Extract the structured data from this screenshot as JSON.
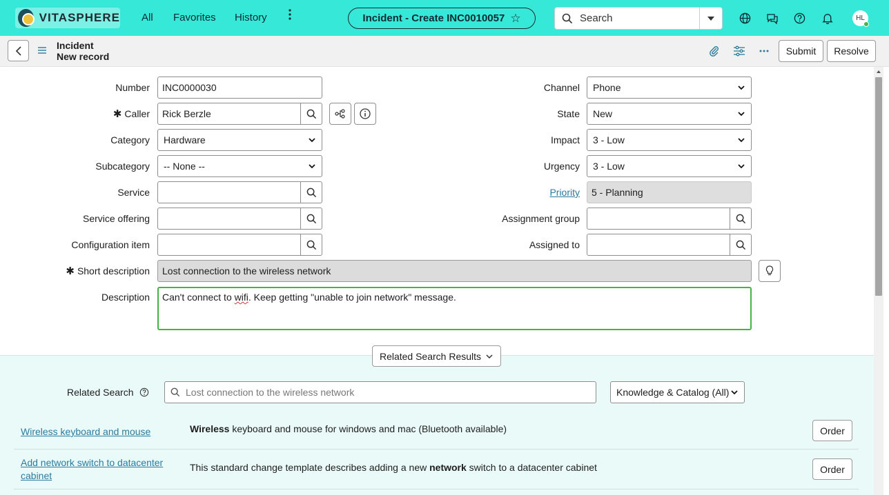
{
  "topnav": {
    "brand": "VITASPHERE",
    "links": [
      "All",
      "Favorites",
      "History"
    ],
    "more_icon": "more-vertical-icon",
    "context_title": "Incident - Create INC0010057",
    "search_label": "Search",
    "icons": [
      "globe-icon",
      "chat-icon",
      "help-icon",
      "bell-icon"
    ],
    "user_initials": "HL",
    "bg_color": "#36e8d8"
  },
  "form_header": {
    "table": "Incident",
    "record": "New record",
    "submit_label": "Submit",
    "resolve_label": "Resolve"
  },
  "fields_left": {
    "number": {
      "label": "Number",
      "value": "INC0000030"
    },
    "caller": {
      "label": "Caller",
      "value": "Rick Berzle"
    },
    "category": {
      "label": "Category",
      "value": "Hardware"
    },
    "subcategory": {
      "label": "Subcategory",
      "value": "-- None --"
    },
    "service": {
      "label": "Service",
      "value": ""
    },
    "service_offering": {
      "label": "Service offering",
      "value": ""
    },
    "configuration_item": {
      "label": "Configuration item",
      "value": ""
    }
  },
  "fields_right": {
    "channel": {
      "label": "Channel",
      "value": "Phone"
    },
    "state": {
      "label": "State",
      "value": "New"
    },
    "impact": {
      "label": "Impact",
      "value": "3 - Low"
    },
    "urgency": {
      "label": "Urgency",
      "value": "3 - Low"
    },
    "priority": {
      "label": "Priority",
      "value": "5 - Planning"
    },
    "assignment_group": {
      "label": "Assignment group",
      "value": ""
    },
    "assigned_to": {
      "label": "Assigned to",
      "value": ""
    }
  },
  "short_description": {
    "label": "Short description",
    "value": "Lost connection to the wireless network"
  },
  "description": {
    "label": "Description",
    "value_before": "Can't connect to ",
    "value_misspelled": "wifi",
    "value_after": ". Keep getting \"unable to join network\" message."
  },
  "related": {
    "toggle_label": "Related Search Results",
    "search_label": "Related Search",
    "search_placeholder": "Lost connection to the wireless network",
    "scope": "Knowledge & Catalog (All)",
    "results": [
      {
        "title": "Wireless keyboard and mouse",
        "desc_bold": "Wireless",
        "desc_rest": " keyboard and mouse for windows and mac (Bluetooth available)",
        "action": "Order"
      },
      {
        "title": "Add network switch to datacenter cabinet",
        "desc_pre": "This standard change template describes adding a new ",
        "desc_bold": "network",
        "desc_post": " switch to a datacenter cabinet",
        "action": "Order"
      }
    ]
  }
}
